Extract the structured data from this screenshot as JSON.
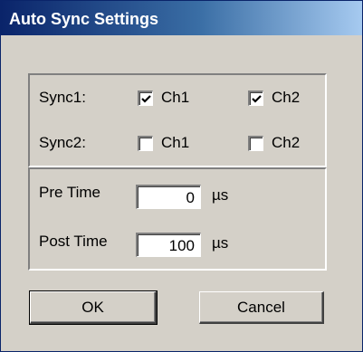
{
  "window": {
    "title": "Auto Sync Settings"
  },
  "sync": {
    "rows": [
      {
        "label": "Sync1:",
        "ch1": {
          "label": "Ch1",
          "checked": true
        },
        "ch2": {
          "label": "Ch2",
          "checked": true
        }
      },
      {
        "label": "Sync2:",
        "ch1": {
          "label": "Ch1",
          "checked": false
        },
        "ch2": {
          "label": "Ch2",
          "checked": false
        }
      }
    ]
  },
  "timing": {
    "pre": {
      "label": "Pre Time",
      "value": "0",
      "unit": "µs"
    },
    "post": {
      "label": "Post Time",
      "value": "100",
      "unit": "µs"
    }
  },
  "buttons": {
    "ok": "OK",
    "cancel": "Cancel"
  }
}
